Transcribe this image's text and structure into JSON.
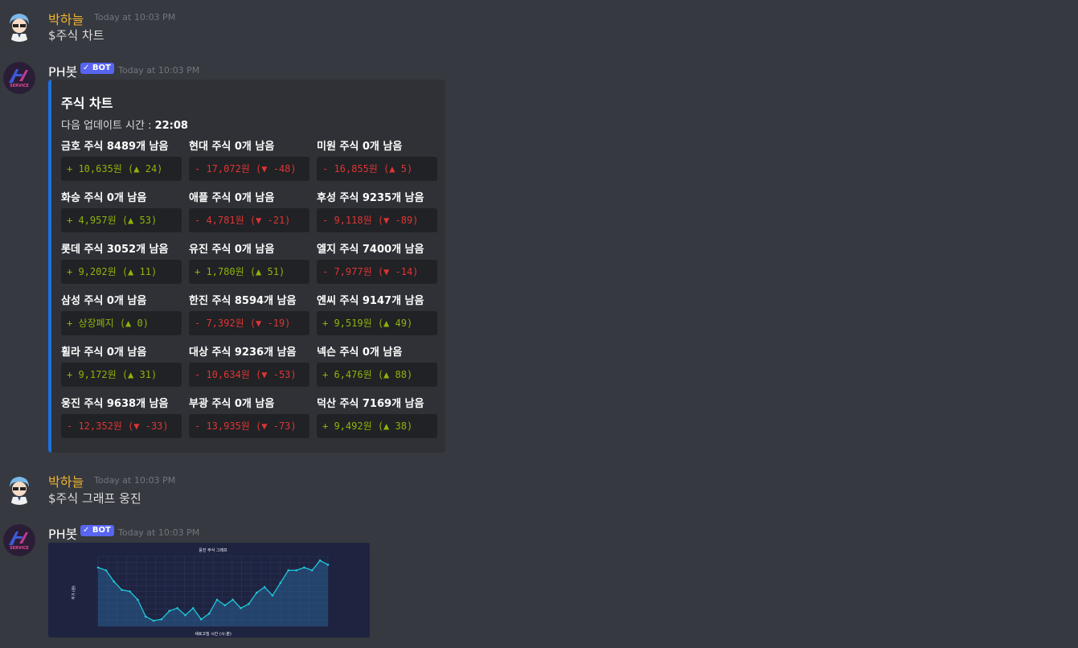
{
  "messages": [
    {
      "author": "박하늘",
      "timestamp": "Today at 10:03 PM",
      "text": "$주식 차트"
    },
    {
      "author": "PH봇",
      "badge": "✓ BOT",
      "timestamp": "Today at 10:03 PM"
    },
    {
      "author": "박하늘",
      "timestamp": "Today at 10:03 PM",
      "text": "$주식 그래프 웅진"
    },
    {
      "author": "PH봇",
      "badge": "✓ BOT",
      "timestamp": "Today at 10:03 PM"
    }
  ],
  "embed": {
    "title": "주식 차트",
    "desc_label": "다음 업데이트 시간 : ",
    "desc_value": "22:08",
    "accent_color": "#1d6fe0",
    "fields": [
      {
        "name": "금호 주식 8489개 남음",
        "value": "+ 10,635원 (▲ 24)",
        "trend": "up"
      },
      {
        "name": "현대 주식 0개 남음",
        "value": "- 17,072원 (▼ -48)",
        "trend": "down"
      },
      {
        "name": "미원 주식 0개 남음",
        "value": "- 16,855원 (▲ 5)",
        "trend": "down"
      },
      {
        "name": "화승 주식 0개 남음",
        "value": "+ 4,957원 (▲ 53)",
        "trend": "up"
      },
      {
        "name": "애플 주식 0개 남음",
        "value": "- 4,781원 (▼ -21)",
        "trend": "down"
      },
      {
        "name": "후성 주식 9235개 남음",
        "value": "- 9,118원 (▼ -89)",
        "trend": "down"
      },
      {
        "name": "롯데 주식 3052개 남음",
        "value": "+ 9,202원 (▲ 11)",
        "trend": "up"
      },
      {
        "name": "유진 주식 0개 남음",
        "value": "+ 1,780원 (▲ 51)",
        "trend": "up"
      },
      {
        "name": "엘지 주식 7400개 남음",
        "value": "- 7,977원 (▼ -14)",
        "trend": "down"
      },
      {
        "name": "삼성 주식 0개 남음",
        "value": "+ 상장폐지 (▲ 0)",
        "trend": "up"
      },
      {
        "name": "한진 주식 8594개 남음",
        "value": "- 7,392원 (▼ -19)",
        "trend": "down"
      },
      {
        "name": "엔씨 주식 9147개 남음",
        "value": "+ 9,519원 (▲ 49)",
        "trend": "up"
      },
      {
        "name": "휠라 주식 0개 남음",
        "value": "+ 9,172원 (▲ 31)",
        "trend": "up"
      },
      {
        "name": "대상 주식 9236개 남음",
        "value": "- 10,634원 (▼ -53)",
        "trend": "down"
      },
      {
        "name": "넥슨 주식 0개 남음",
        "value": "+ 6,476원 (▲ 88)",
        "trend": "up"
      },
      {
        "name": "웅진 주식 9638개 남음",
        "value": "- 12,352원 (▼ -33)",
        "trend": "down"
      },
      {
        "name": "부광 주식 0개 남음",
        "value": "- 13,935원 (▼ -73)",
        "trend": "down"
      },
      {
        "name": "덕산 주식 7169개 남음",
        "value": "+ 9,492원 (▲ 38)",
        "trend": "up"
      }
    ]
  },
  "colors": {
    "up": "#8fb30a",
    "down": "#e03434",
    "user_name": "#f0b232",
    "bot_badge": "#5865f2"
  },
  "chart_data": {
    "type": "line",
    "title": "웅진 주식 그래프",
    "xlabel": "새로고침 시간 (시:분)",
    "ylabel": "주가 (원)",
    "y": [
      12400,
      12300,
      11900,
      11600,
      11550,
      11250,
      10650,
      10500,
      10550,
      10850,
      10950,
      10700,
      10950,
      10550,
      10750,
      11250,
      11050,
      11250,
      10950,
      11100,
      11500,
      11700,
      11400,
      11850,
      12300,
      12300,
      12400,
      12300,
      12650,
      12500
    ],
    "ylim": [
      10300,
      12800
    ],
    "grid": true
  }
}
